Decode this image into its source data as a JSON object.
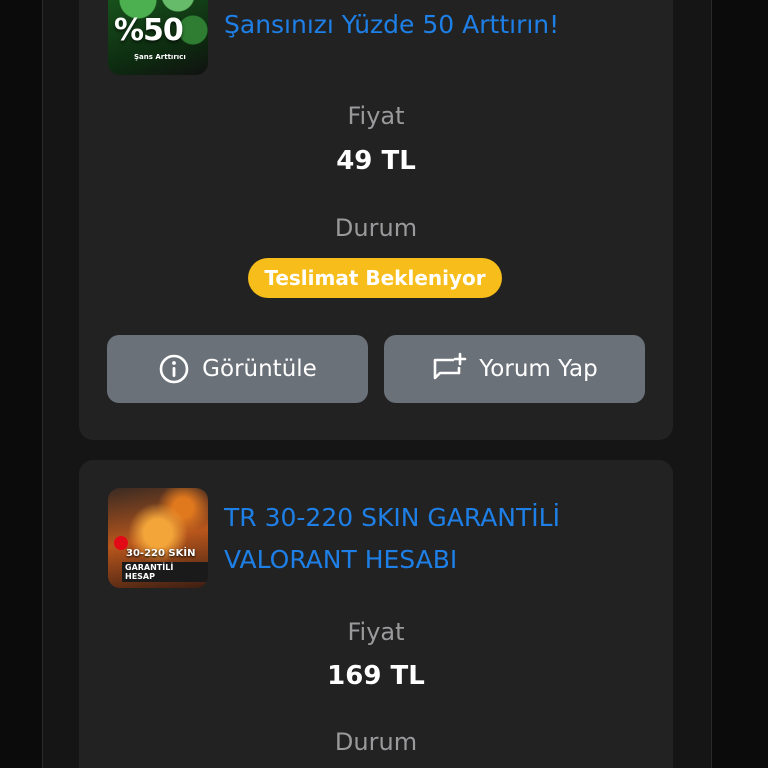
{
  "orders": [
    {
      "thumb": {
        "big_text": "%50",
        "small_text": "Şans Arttırıcı",
        "icon": "clover-boost-image"
      },
      "title": "Şansınızı Yüzde 50 Arttırın!",
      "price_label": "Fiyat",
      "price": "49 TL",
      "status_label": "Durum",
      "status": "Teslimat Bekleniyor",
      "status_color": "#f7bd1a",
      "buttons": {
        "view": {
          "label": "Görüntüle",
          "icon": "info-icon"
        },
        "comment": {
          "label": "Yorum Yap",
          "icon": "add-comment-icon"
        }
      }
    },
    {
      "thumb": {
        "line1": "30-220 SKİN",
        "line2": "GARANTİLİ HESAP",
        "icon": "valorant-account-image"
      },
      "title": "TR 30-220 SKIN GARANTİLİ VALORANT HESABI",
      "price_label": "Fiyat",
      "price": "169 TL",
      "status_label": "Durum"
    }
  ],
  "colors": {
    "background": "#0b0b0c",
    "card": "#222223",
    "title": "#1e7fe6",
    "button": "#6b7178"
  }
}
